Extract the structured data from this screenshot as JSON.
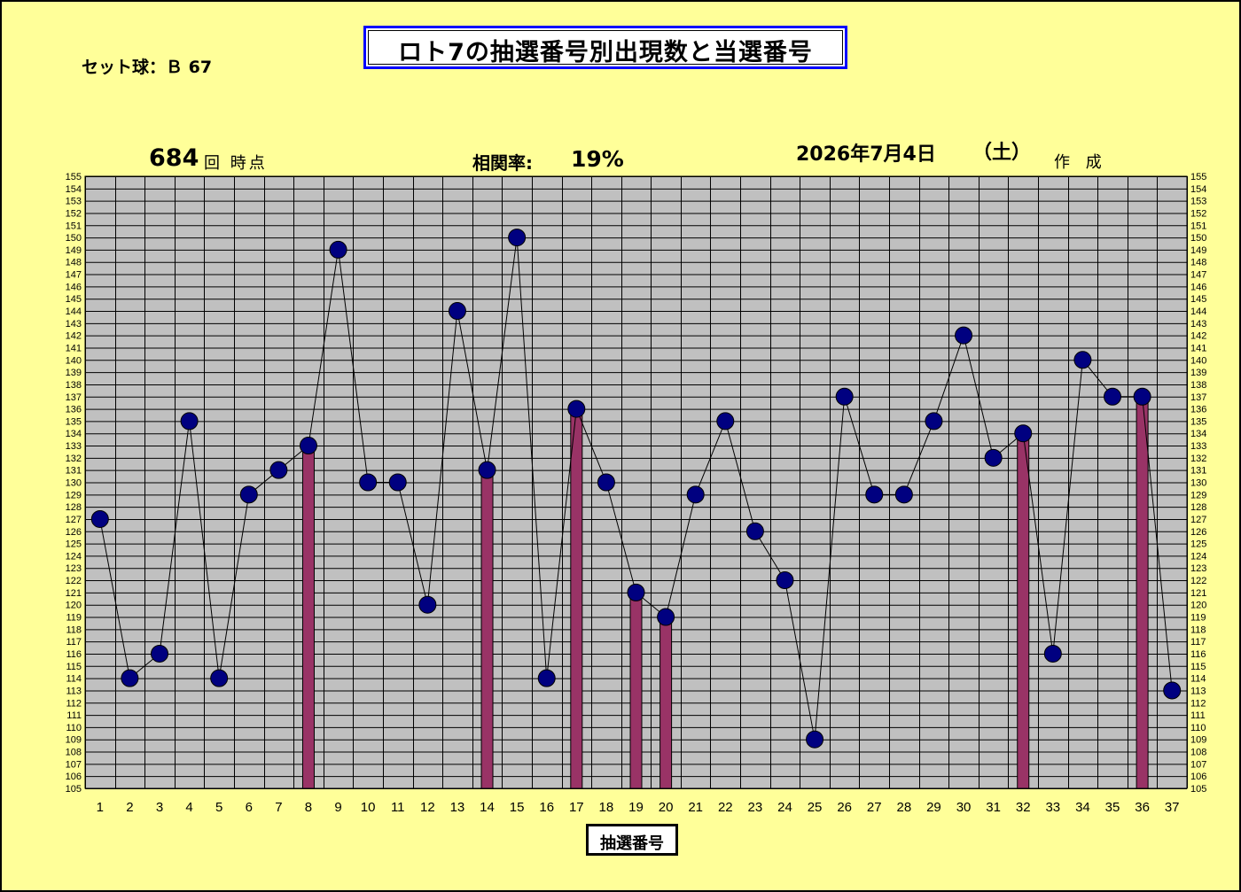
{
  "header": {
    "title": "ロト7の抽選番号別出現数と当選番号",
    "set_ball": "セット球：Ｂ 67",
    "draw_count": "684",
    "draw_suffix": "回 時点",
    "correlation_label": "相関率:",
    "correlation_value": "19%",
    "date": "2026年7月4日",
    "weekday": "（土）",
    "made": "作 成"
  },
  "colors": {
    "background": "#ffff99",
    "plot_area": "#c0c0c0",
    "bar": "#993366",
    "marker": "#000080",
    "title_border": "#0000ff"
  },
  "chart_data": {
    "type": "bar",
    "xlabel": "抽選番号",
    "ylim": [
      105,
      155
    ],
    "grid": true,
    "categories": [
      "1",
      "2",
      "3",
      "4",
      "5",
      "6",
      "7",
      "8",
      "9",
      "10",
      "11",
      "12",
      "13",
      "14",
      "15",
      "16",
      "17",
      "18",
      "19",
      "20",
      "21",
      "22",
      "23",
      "24",
      "25",
      "26",
      "27",
      "28",
      "29",
      "30",
      "31",
      "32",
      "33",
      "34",
      "35",
      "36",
      "37"
    ],
    "series": [
      {
        "type": "line",
        "values": [
          127,
          114,
          116,
          135,
          114,
          129,
          131,
          133,
          149,
          130,
          130,
          120,
          144,
          131,
          150,
          114,
          136,
          130,
          121,
          119,
          129,
          135,
          126,
          122,
          109,
          137,
          129,
          129,
          135,
          142,
          132,
          134,
          116,
          140,
          137,
          137,
          113
        ]
      },
      {
        "type": "bar",
        "values": [
          null,
          null,
          null,
          null,
          null,
          null,
          null,
          133,
          null,
          null,
          null,
          null,
          null,
          131,
          null,
          null,
          136,
          null,
          121,
          119,
          null,
          null,
          null,
          null,
          null,
          null,
          null,
          null,
          null,
          null,
          null,
          134,
          null,
          null,
          null,
          137,
          null
        ]
      }
    ]
  }
}
